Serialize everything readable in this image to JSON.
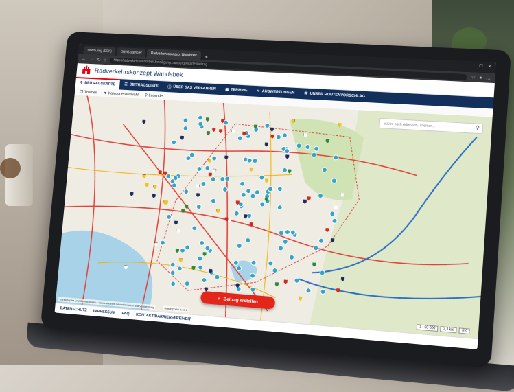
{
  "browser": {
    "tabs": [
      {
        "label": "DIWG.img (DEK)"
      },
      {
        "label": "DIWG-sampler"
      },
      {
        "label": "Radverkehrskonzept Wandsbek"
      }
    ],
    "url": "https://radverkehr-wandsbek.beteiligung.hamburg/#/kartenbeitrag",
    "new_tab_glyph": "+"
  },
  "app": {
    "title": "Radverkehrskonzept Wandsbek"
  },
  "nav": [
    {
      "label": "BEITRAGSKARTE",
      "icon": "map-pin-icon",
      "active": true
    },
    {
      "label": "BEITRAGSLISTE",
      "icon": "list-icon"
    },
    {
      "label": "ÜBER DAS VERFAHREN",
      "icon": "info-icon"
    },
    {
      "label": "TERMINE",
      "icon": "calendar-icon"
    },
    {
      "label": "AUSWERTUNGEN",
      "icon": "chart-icon"
    },
    {
      "label": "UNSER ROUTENVORSCHLAG",
      "icon": "route-icon"
    }
  ],
  "subbar": [
    {
      "label": "Themen",
      "icon": "layers-icon"
    },
    {
      "label": "Kategorienauswahl",
      "icon": "filter-icon"
    },
    {
      "label": "Legende",
      "icon": "legend-icon"
    }
  ],
  "map": {
    "search_placeholder": "Suche nach Adressen, Themen...",
    "attribution": "Kartographie und Geofachdaten · Landesbetrieb Geoinformation und Vermessung",
    "version": "Masterportal 2.10.1",
    "scale": "1 : 60 000",
    "scale_bar": "2,3 km",
    "zoom_label": "EK",
    "colors": {
      "cluster": "#36a3c9",
      "pin_red": "#d7261b",
      "pin_yellow": "#f2c31b",
      "pin_green": "#2a8a3a",
      "pin_navy": "#1c2a5e",
      "pin_white": "#ffffff",
      "road": "#e0413a",
      "water": "#a8d2e8",
      "rail": "#2a6fc4"
    }
  },
  "create_button": {
    "label": "Beitrag erstellen",
    "icon": "plus-icon"
  },
  "footer": [
    {
      "label": "DATENSCHUTZ"
    },
    {
      "label": "IMPRESSUM"
    },
    {
      "label": "FAQ"
    },
    {
      "label": "KONTAKT/BARRIEREFREIHEIT"
    }
  ]
}
